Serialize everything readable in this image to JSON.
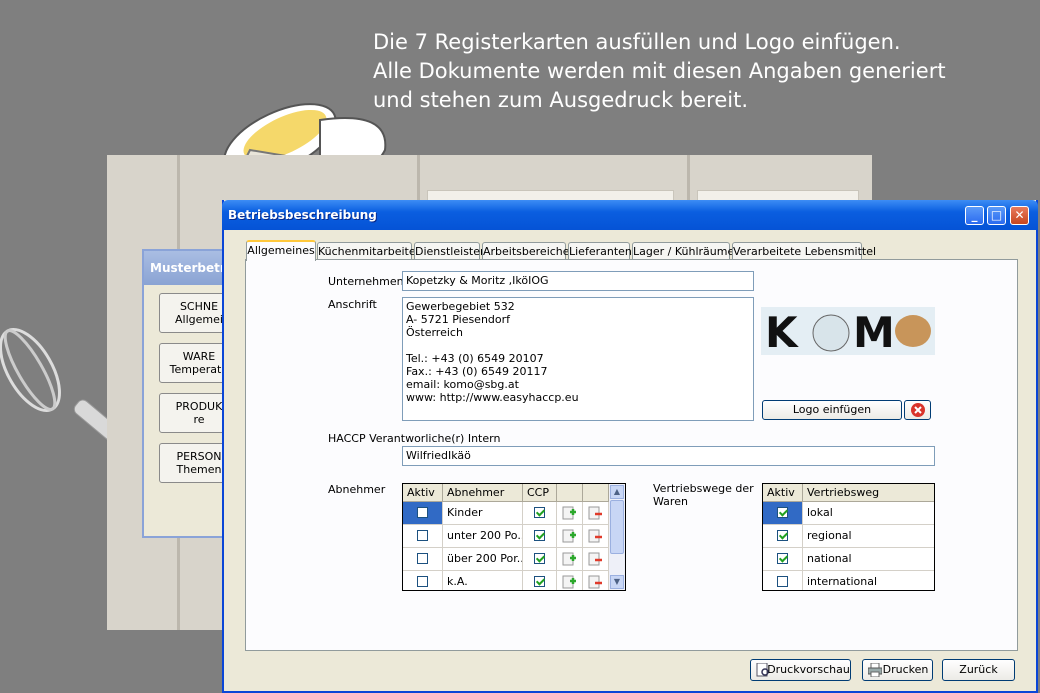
{
  "banner": {
    "line1": "Die 7 Registerkarten ausfüllen und Logo einfügen.",
    "line2": "Alle Dokumente werden mit diesen Angaben generiert",
    "line3": "und stehen zum  Ausgedruck bereit."
  },
  "background_dialog": {
    "title": "Musterbetrieb",
    "buttons": [
      {
        "line1": "SCHNE",
        "line2": "Allgemei"
      },
      {
        "line1": "WARE",
        "line2": "Temperatu"
      },
      {
        "line1": "PRODUK",
        "line2": "re"
      },
      {
        "line1": "PERSON",
        "line2": "Themen"
      }
    ]
  },
  "window": {
    "title": "Betriebsbeschreibung",
    "tabs": [
      "Allgemeines",
      "Küchenmitarbeiter",
      "Dienstleister",
      "Arbeitsbereiche",
      "Lieferanten",
      "Lager / Kühlräume",
      "Verarbeitete Lebensmittel"
    ],
    "active_tab": "Allgemeines"
  },
  "form": {
    "unternehmen_label": "Unternehmen",
    "unternehmen_value": "Kopetzky & Moritz ,IköIOG",
    "anschrift_label": "Anschrift",
    "anschrift_lines": [
      "Gewerbegebiet 532",
      "A- 5721 Piesendorf",
      "Österreich",
      "",
      "Tel.: +43 (0) 6549 20107",
      "Fax.: +43 (0) 6549 20117",
      "email: komo@sbg.at",
      "www: http://www.easyhaccp.eu"
    ],
    "haccp_label": "HACCP Verantworliche(r) Intern",
    "haccp_value": "WilfriedIkäö",
    "logo_text": "KOMO",
    "logo_button": "Logo einfügen",
    "abnehmer_label": "Abnehmer",
    "vertrieb_label_1": "Vertriebswege der",
    "vertrieb_label_2": "Waren"
  },
  "abnehmer_table": {
    "headers": [
      "Aktiv",
      "Abnehmer",
      "CCP"
    ],
    "rows": [
      {
        "aktiv": false,
        "name": "Kinder",
        "ccp": true
      },
      {
        "aktiv": false,
        "name": "unter 200 Po...",
        "ccp": true
      },
      {
        "aktiv": false,
        "name": "über 200 Por...",
        "ccp": true
      },
      {
        "aktiv": false,
        "name": "k.A.",
        "ccp": true
      }
    ]
  },
  "vertrieb_table": {
    "headers": [
      "Aktiv",
      "Vertriebsweg"
    ],
    "rows": [
      {
        "aktiv": true,
        "name": "lokal"
      },
      {
        "aktiv": true,
        "name": "regional"
      },
      {
        "aktiv": true,
        "name": "national"
      },
      {
        "aktiv": false,
        "name": "international"
      }
    ]
  },
  "footer": {
    "preview": "Druckvorschau",
    "print": "Drucken",
    "back": "Zurück"
  },
  "colors": {
    "titlebar": "#0a5ee0",
    "tab_highlight": "#ffc83c",
    "selection": "#316ac5"
  }
}
